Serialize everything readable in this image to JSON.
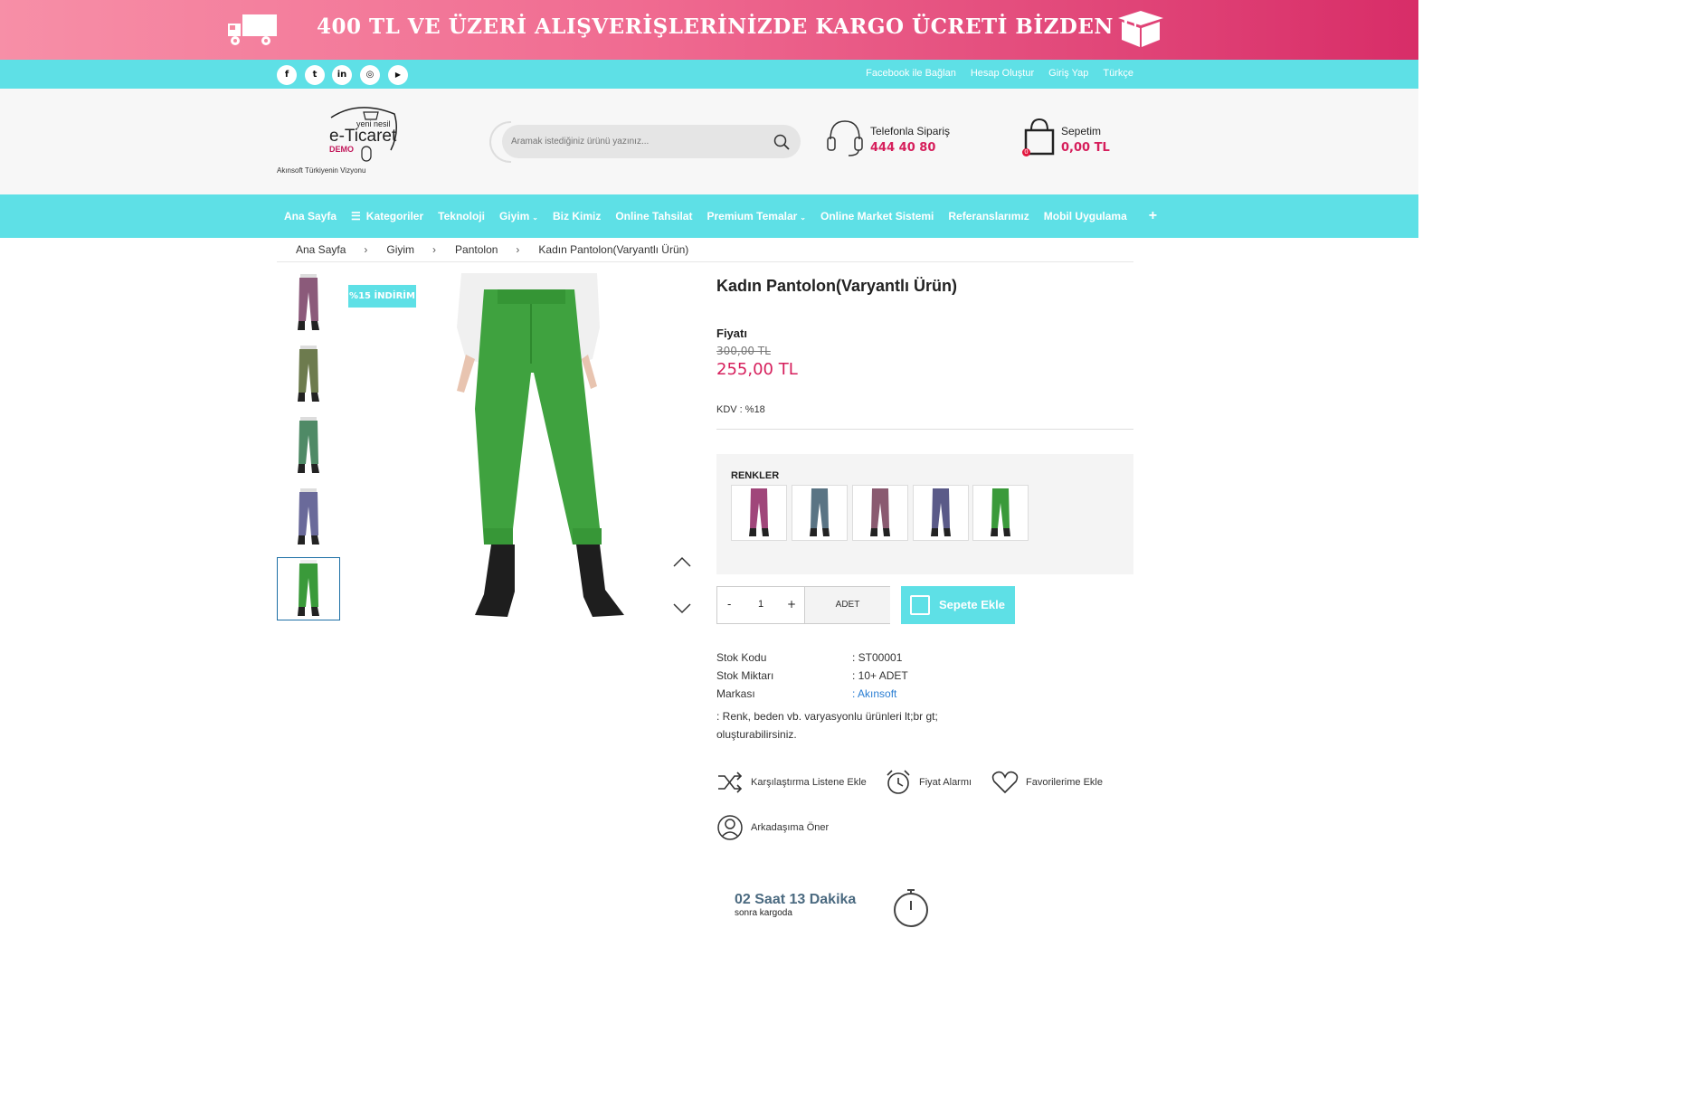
{
  "banner": {
    "message": "400 TL VE ÜZERİ ALIŞVERİŞLERİNİZDE KARGO ÜCRETİ BİZDEN !!"
  },
  "social": [
    {
      "icon": "facebook-icon",
      "glyph": "f"
    },
    {
      "icon": "twitter-icon",
      "glyph": "t"
    },
    {
      "icon": "linkedin-icon",
      "glyph": "in"
    },
    {
      "icon": "instagram-icon",
      "glyph": "◎"
    },
    {
      "icon": "youtube-icon",
      "glyph": "▶"
    }
  ],
  "toplinks": [
    "Facebook ile Bağlan",
    "Hesap Oluştur",
    "Giriş Yap",
    "Türkçe"
  ],
  "logo": {
    "line1": "yeni nesil",
    "line2": "e-Ticaret",
    "line3": "DEMO",
    "tagline": "Akınsoft Türkiyenin Vizyonu"
  },
  "search": {
    "placeholder": "Aramak istediğiniz ürünü yazınız..."
  },
  "phone": {
    "label": "Telefonla Sipariş",
    "number": "444 40 80"
  },
  "cart": {
    "label": "Sepetim",
    "amount": "0,00 TL",
    "count": "0"
  },
  "nav": [
    "Ana Sayfa",
    "Kategoriler",
    "Teknoloji",
    "Giyim",
    "Biz Kimiz",
    "Online Tahsilat",
    "Premium Temalar",
    "Online Market Sistemi",
    "Referanslarımız",
    "Mobil Uygulama",
    "+"
  ],
  "breadcrumb": [
    "Ana Sayfa",
    "Giyim",
    "Pantolon",
    "Kadın Pantolon(Varyantlı Ürün)"
  ],
  "product": {
    "discount_badge": "%15 İNDİRİM",
    "title": "Kadın Pantolon(Varyantlı Ürün)",
    "price_label": "Fiyatı",
    "old_price": "300,00 TL",
    "new_price": "255,00 TL",
    "kdv": "KDV : %18",
    "colors_title": "RENKLER",
    "quantity": "1",
    "unit": "ADET",
    "add_to_cart": "Sepete Ekle",
    "stock_code_label": "Stok Kodu",
    "stock_code": ": ST00001",
    "stock_qty_label": "Stok Miktarı",
    "stock_qty": ": 10+ ADET",
    "brand_label": "Markası",
    "brand": ": Akınsoft",
    "description": ": Renk, beden vb. varyasyonlu ürünleri lt;br gt; oluşturabilirsiniz."
  },
  "actions": {
    "compare": "Karşılaştırma Listene Ekle",
    "price_alarm": "Fiyat Alarmı",
    "favorites": "Favorilerime Ekle",
    "recommend": "Arkadaşıma Öner"
  },
  "cargo": {
    "time": "02 Saat 13 Dakika",
    "sub": "sonra kargoda"
  },
  "colors": {
    "accent": "#5ee0e6",
    "price": "#d61f5c",
    "thumbs": [
      "#8b5a7a",
      "#6d7b4e",
      "#4f8a66",
      "#6a6a9a",
      "#3a9a3a"
    ],
    "swatches": [
      "#a0467a",
      "#5a7484",
      "#8a5a70",
      "#5a5a88",
      "#3a9a3a"
    ]
  }
}
